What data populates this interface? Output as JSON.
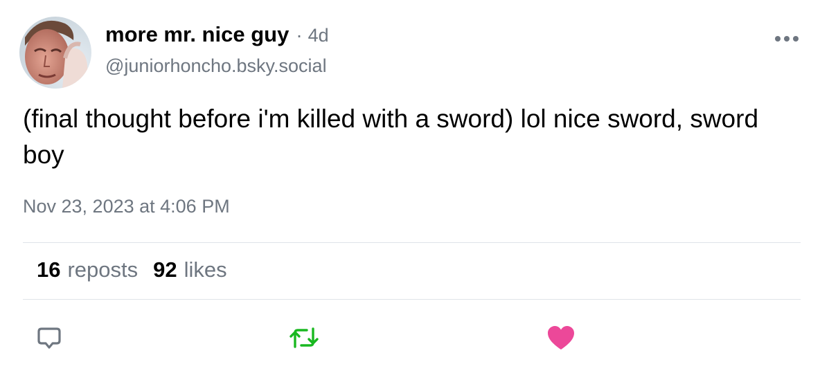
{
  "post": {
    "author": {
      "display_name": "more mr. nice guy",
      "handle": "@juniorhoncho.bsky.social",
      "time_ago": "4d",
      "separator": "·",
      "avatar_icon": "avatar-photo"
    },
    "text": "(final thought before i'm killed with a sword) lol nice sword, sword boy",
    "timestamp": "Nov 23, 2023 at 4:06 PM",
    "stats": {
      "reposts_count": "16",
      "reposts_label": "reposts",
      "likes_count": "92",
      "likes_label": "likes"
    },
    "actions": {
      "reply_icon": "speech-bubble-icon",
      "repost_icon": "repost-arrows-icon",
      "like_icon": "heart-icon",
      "menu_icon": "ellipsis-icon"
    },
    "colors": {
      "text": "#000000",
      "secondary_text": "#6e7680",
      "divider": "#dfe3e8",
      "reply_icon": "#6e7680",
      "repost_active": "#19b820",
      "like_active": "#ec4899"
    }
  }
}
